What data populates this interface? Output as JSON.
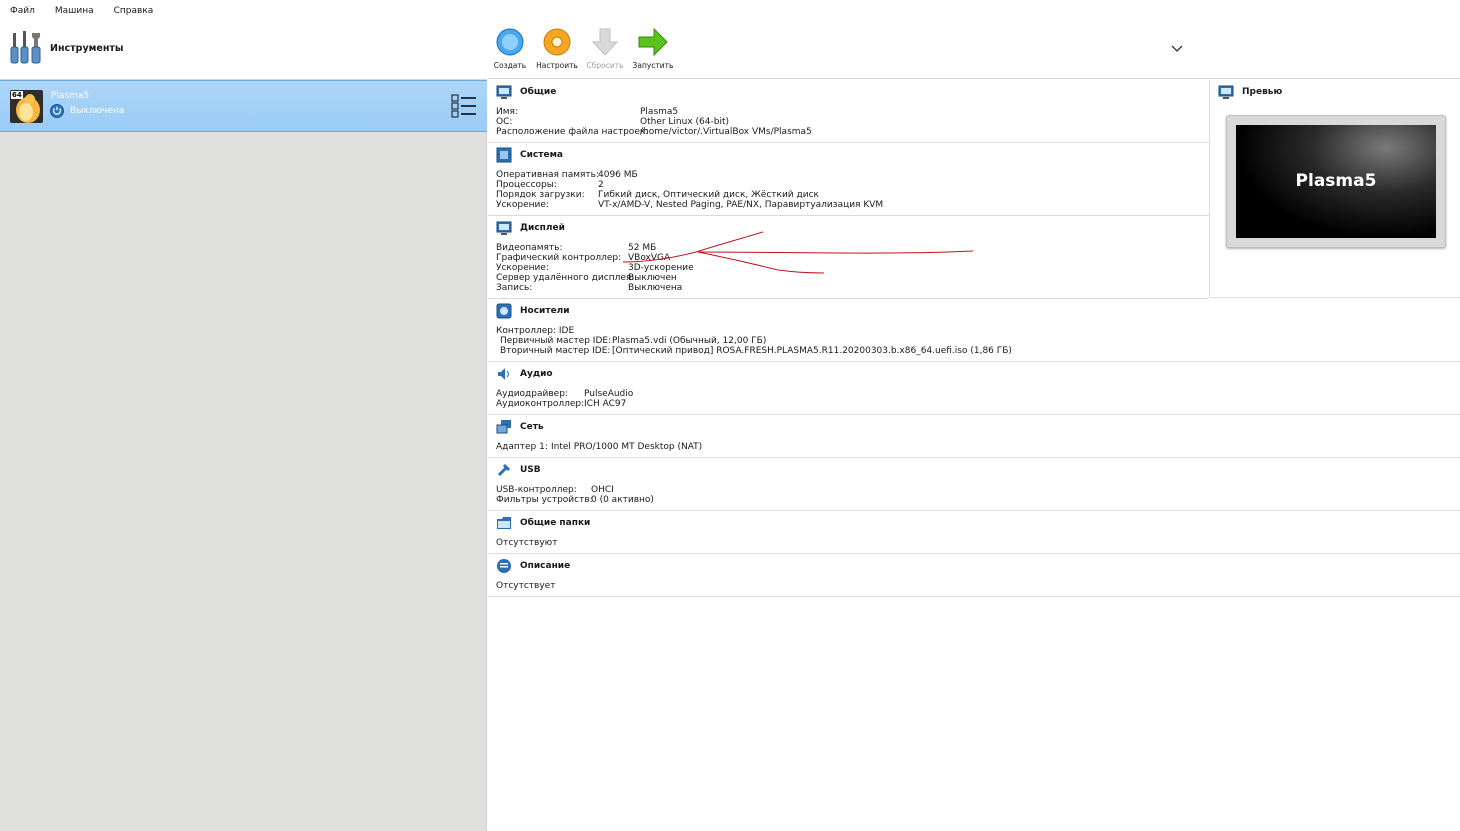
{
  "menu": [
    "Файл",
    "Машина",
    "Справка"
  ],
  "tools": {
    "label": "Инструменты",
    "icon": "tools-icon"
  },
  "vm": {
    "name": "Plasma5",
    "state": "Выключена",
    "badge": "64",
    "os_icon": "linux-tux-icon"
  },
  "toolbar": {
    "buttons": [
      {
        "label": "Создать",
        "icon": "new-star-icon",
        "enabled": true
      },
      {
        "label": "Настроить",
        "icon": "settings-gear-icon",
        "enabled": true
      },
      {
        "label": "Сбросить",
        "icon": "discard-arrow-icon",
        "enabled": false
      },
      {
        "label": "Запустить",
        "icon": "start-arrow-icon",
        "enabled": true
      }
    ]
  },
  "sections": {
    "general": {
      "title": "Общие",
      "rows": [
        {
          "k": "Имя:",
          "v": "Plasma5"
        },
        {
          "k": "ОС:",
          "v": "Other Linux (64-bit)"
        },
        {
          "k": "Расположение файла настроек:",
          "v": "/home/victor/.VirtualBox VMs/Plasma5"
        }
      ]
    },
    "system": {
      "title": "Система",
      "rows": [
        {
          "k": "Оперативная память:",
          "v": "4096 МБ"
        },
        {
          "k": "Процессоры:",
          "v": "2"
        },
        {
          "k": "Порядок загрузки:",
          "v": "Гибкий диск, Оптический диск, Жёсткий диск"
        },
        {
          "k": "Ускорение:",
          "v": "VT-x/AMD-V, Nested Paging, PAE/NX, Паравиртуализация KVM"
        }
      ]
    },
    "display": {
      "title": "Дисплей",
      "rows": [
        {
          "k": "Видеопамять:",
          "v": "52 МБ"
        },
        {
          "k": "Графический контроллер:",
          "v": "VBoxVGA"
        },
        {
          "k": "Ускорение:",
          "v": "3D-ускорение"
        },
        {
          "k": "Сервер удалённого дисплея:",
          "v": "Выключен"
        },
        {
          "k": "Запись:",
          "v": "Выключена"
        }
      ]
    },
    "storage": {
      "title": "Носители",
      "rows": [
        {
          "k": "Контроллер: IDE",
          "v": ""
        },
        {
          "k": " Первичный мастер IDE:",
          "v": "Plasma5.vdi (Обычный, 12,00 ГБ)"
        },
        {
          "k": " Вторичный мастер IDE:",
          "v": "[Оптический привод] ROSA.FRESH.PLASMA5.R11.20200303.b.x86_64.uefi.iso (1,86 ГБ)"
        }
      ]
    },
    "audio": {
      "title": "Аудио",
      "rows": [
        {
          "k": "Аудиодрайвер:",
          "v": "PulseAudio"
        },
        {
          "k": "Аудиоконтроллер:",
          "v": "ICH AC97"
        }
      ]
    },
    "network": {
      "title": "Сеть",
      "rows": [
        {
          "k": "Адаптер 1:",
          "v": "Intel PRO/1000 MT Desktop (NAT)"
        }
      ]
    },
    "usb": {
      "title": "USB",
      "rows": [
        {
          "k": "USB-контроллер:",
          "v": "OHCI"
        },
        {
          "k": "Фильтры устройств:",
          "v": "0 (0 активно)"
        }
      ]
    },
    "shared": {
      "title": "Общие папки",
      "rows": [
        {
          "k": "Отсутствуют",
          "v": ""
        }
      ]
    },
    "description": {
      "title": "Описание",
      "rows": [
        {
          "k": "Отсутствует",
          "v": ""
        }
      ]
    }
  },
  "preview": {
    "title": "Превью",
    "screen_text": "Plasma5"
  },
  "colors": {
    "selection": "#99cbf5",
    "annotation": "#c0141b",
    "accent": "#2b76b9"
  }
}
